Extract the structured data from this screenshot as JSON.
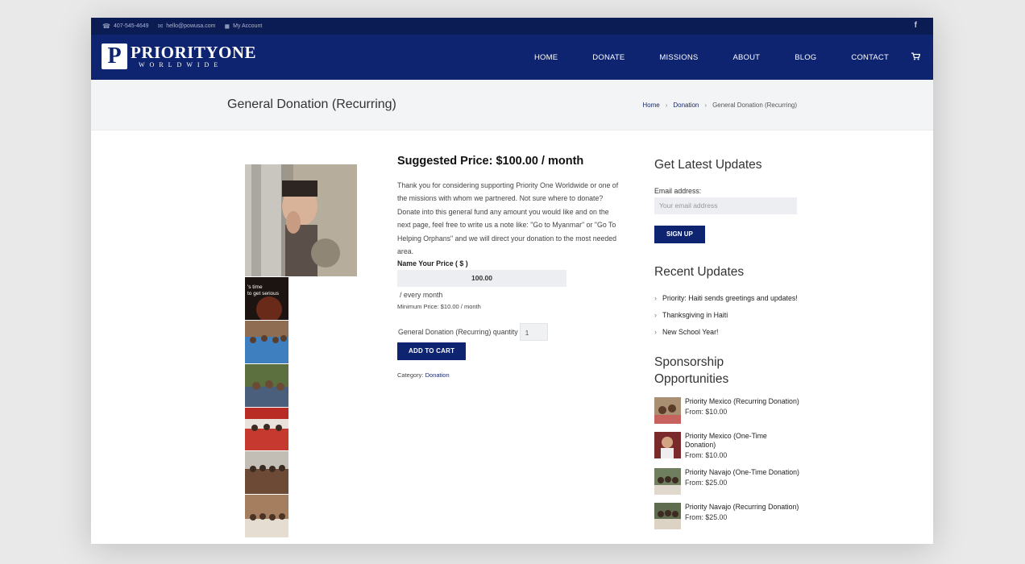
{
  "topbar": {
    "phone": "407-545-4649",
    "email": "hello@powusa.com",
    "account": "My Account",
    "social_icon": "f"
  },
  "logo": {
    "letter": "P",
    "line1": "PRIORITYONE",
    "line2": "WORLDWIDE"
  },
  "nav": {
    "items": [
      "HOME",
      "DONATE",
      "MISSIONS",
      "ABOUT",
      "BLOG",
      "CONTACT"
    ],
    "cart_icon": "cart-icon"
  },
  "page": {
    "title": "General Donation (Recurring)",
    "breadcrumb": [
      "Home",
      "Donation",
      "General Donation (Recurring)"
    ]
  },
  "product": {
    "heading": "Suggested Price: $100.00 / month",
    "description": "Thank you for considering supporting Priority One Worldwide or one of the missions with whom we partnered. Not sure where to donate? Donate into this general fund any amount you would like and on the next page, feel free to write us a note like: \"Go to Myanmar\" or \"Go To Helping Orphans\" and we will direct your donation to the most needed area.",
    "name_price_label": "Name Your Price ( $ )",
    "price_value": "100.00",
    "period": "/ every month",
    "min_price": "Minimum Price: $10.00 / month",
    "qty_label": "General Donation (Recurring) quantity",
    "qty_value": "1",
    "add_to_cart": "ADD TO CART",
    "category_label": "Category:",
    "category_value": "Donation",
    "thumb_caption": "'s time to get serious"
  },
  "sidebar": {
    "updates_title": "Get Latest Updates",
    "email_label": "Email address:",
    "email_placeholder": "Your email address",
    "signup": "SIGN UP",
    "recent_title": "Recent Updates",
    "recent": [
      "Priority: Haiti sends greetings and updates!",
      "Thanksgiving in Haiti",
      "New School Year!"
    ],
    "sponsor_title": "Sponsorship Opportunities",
    "sponsors": [
      {
        "name": "Priority Mexico (Recurring Donation)",
        "price": "From: $10.00"
      },
      {
        "name": "Priority Mexico (One-Time Donation)",
        "price": "From: $10.00"
      },
      {
        "name": "Priority Navajo (One-Time Donation)",
        "price": "From: $25.00"
      },
      {
        "name": "Priority Navajo (Recurring Donation)",
        "price": "From: $25.00"
      }
    ]
  }
}
